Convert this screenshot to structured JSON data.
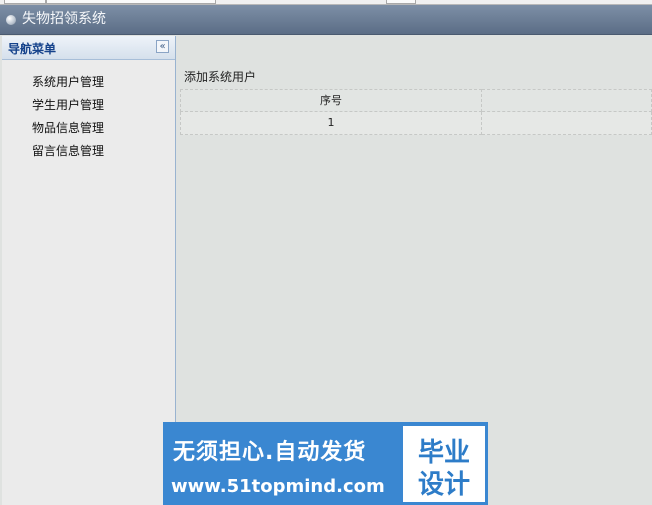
{
  "window": {
    "title": "失物招领系统"
  },
  "sidebar": {
    "header": "导航菜单",
    "collapse_glyph": "«",
    "items": [
      {
        "label": "系统用户管理"
      },
      {
        "label": "学生用户管理"
      },
      {
        "label": "物品信息管理"
      },
      {
        "label": "留言信息管理"
      }
    ]
  },
  "main": {
    "section_title": "添加系统用户",
    "table": {
      "columns": [
        "序号",
        ""
      ],
      "rows": [
        [
          "1",
          ""
        ]
      ]
    }
  },
  "banner": {
    "line1": "无须担心.自动发货",
    "line2": "www.51topmind.com",
    "badge_line1": "毕业",
    "badge_line2": "设计"
  }
}
